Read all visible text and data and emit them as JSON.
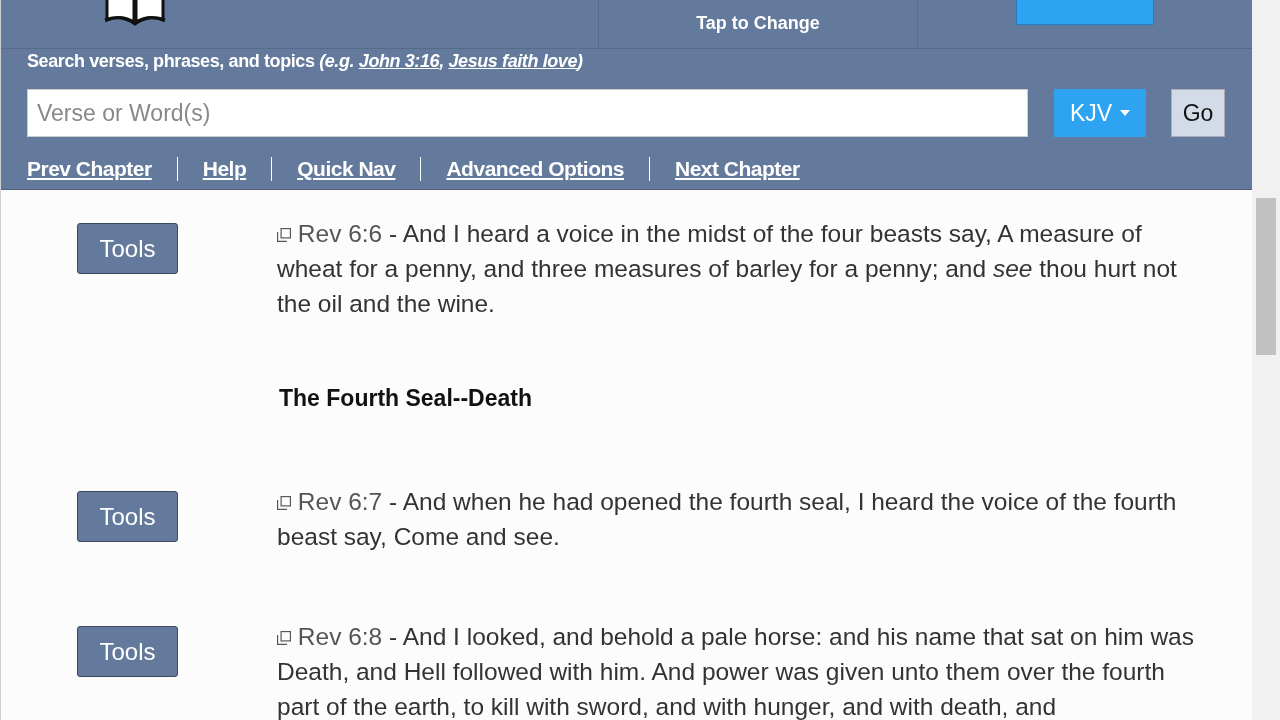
{
  "header": {
    "version_hint": "Tap to Change"
  },
  "search": {
    "label": "Search verses, phrases, and topics",
    "example_prefix": "(e.g. ",
    "examples": [
      "John 3:16",
      "Jesus faith love"
    ],
    "example_separator": ", ",
    "verse_separator": " - ",
    "example_suffix": ")",
    "placeholder": "Verse or Word(s)",
    "version": "KJV",
    "go": "Go"
  },
  "nav_links": [
    "Prev Chapter",
    "Help",
    "Quick Nav",
    "Advanced Options",
    "Next Chapter"
  ],
  "items": [
    {
      "kind": "verse",
      "tools": "Tools",
      "ref": "Rev 6:6",
      "text": "And I heard a voice in the midst of the four beasts say, A measure of wheat for a penny, and three measures of barley for a penny; and *see* thou hurt not the oil and the wine."
    },
    {
      "kind": "heading",
      "text": "The Fourth Seal--Death"
    },
    {
      "kind": "verse",
      "tools": "Tools",
      "ref": "Rev 6:7",
      "text": "And when he had opened the fourth seal, I heard the voice of the fourth beast say, Come and see."
    },
    {
      "kind": "verse",
      "tools": "Tools",
      "ref": "Rev 6:8",
      "text": "And I looked, and behold a pale horse: and his name that sat on him was Death, and Hell followed with him. And power was given unto them over the fourth part of the earth, to kill with sword, and with hunger, and with death, and"
    }
  ]
}
